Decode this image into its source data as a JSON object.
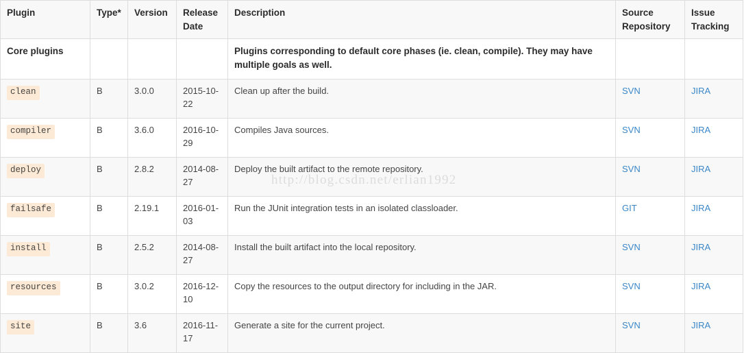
{
  "table": {
    "columns": [
      "Plugin",
      "Type*",
      "Version",
      "Release Date",
      "Description",
      "Source Repository",
      "Issue Tracking"
    ],
    "group_row": {
      "name": "Core plugins",
      "description": "Plugins corresponding to default core phases (ie. clean, compile). They may have multiple goals as well."
    },
    "rows": [
      {
        "plugin": "clean",
        "type": "B",
        "version": "3.0.0",
        "release_date": "2015-10-22",
        "description": "Clean up after the build.",
        "source_repository": "SVN",
        "issue_tracking": "JIRA"
      },
      {
        "plugin": "compiler",
        "type": "B",
        "version": "3.6.0",
        "release_date": "2016-10-29",
        "description": "Compiles Java sources.",
        "source_repository": "SVN",
        "issue_tracking": "JIRA"
      },
      {
        "plugin": "deploy",
        "type": "B",
        "version": "2.8.2",
        "release_date": "2014-08-27",
        "description": "Deploy the built artifact to the remote repository.",
        "source_repository": "SVN",
        "issue_tracking": "JIRA"
      },
      {
        "plugin": "failsafe",
        "type": "B",
        "version": "2.19.1",
        "release_date": "2016-01-03",
        "description": "Run the JUnit integration tests in an isolated classloader.",
        "source_repository": "GIT",
        "issue_tracking": "JIRA"
      },
      {
        "plugin": "install",
        "type": "B",
        "version": "2.5.2",
        "release_date": "2014-08-27",
        "description": "Install the built artifact into the local repository.",
        "source_repository": "SVN",
        "issue_tracking": "JIRA"
      },
      {
        "plugin": "resources",
        "type": "B",
        "version": "3.0.2",
        "release_date": "2016-12-10",
        "description": "Copy the resources to the output directory for including in the JAR.",
        "source_repository": "SVN",
        "issue_tracking": "JIRA"
      },
      {
        "plugin": "site",
        "type": "B",
        "version": "3.6",
        "release_date": "2016-11-17",
        "description": "Generate a site for the current project.",
        "source_repository": "SVN",
        "issue_tracking": "JIRA"
      }
    ]
  },
  "watermark": {
    "text": "http://blog.csdn.net/erlian1992"
  },
  "colors": {
    "link": "#3a87c8",
    "plugin_badge_bg": "#fcead6",
    "header_bg": "#f8f8f8",
    "stripe_bg": "#f8f8f8",
    "border": "#dddddd",
    "watermark": "#dcdcdc"
  }
}
